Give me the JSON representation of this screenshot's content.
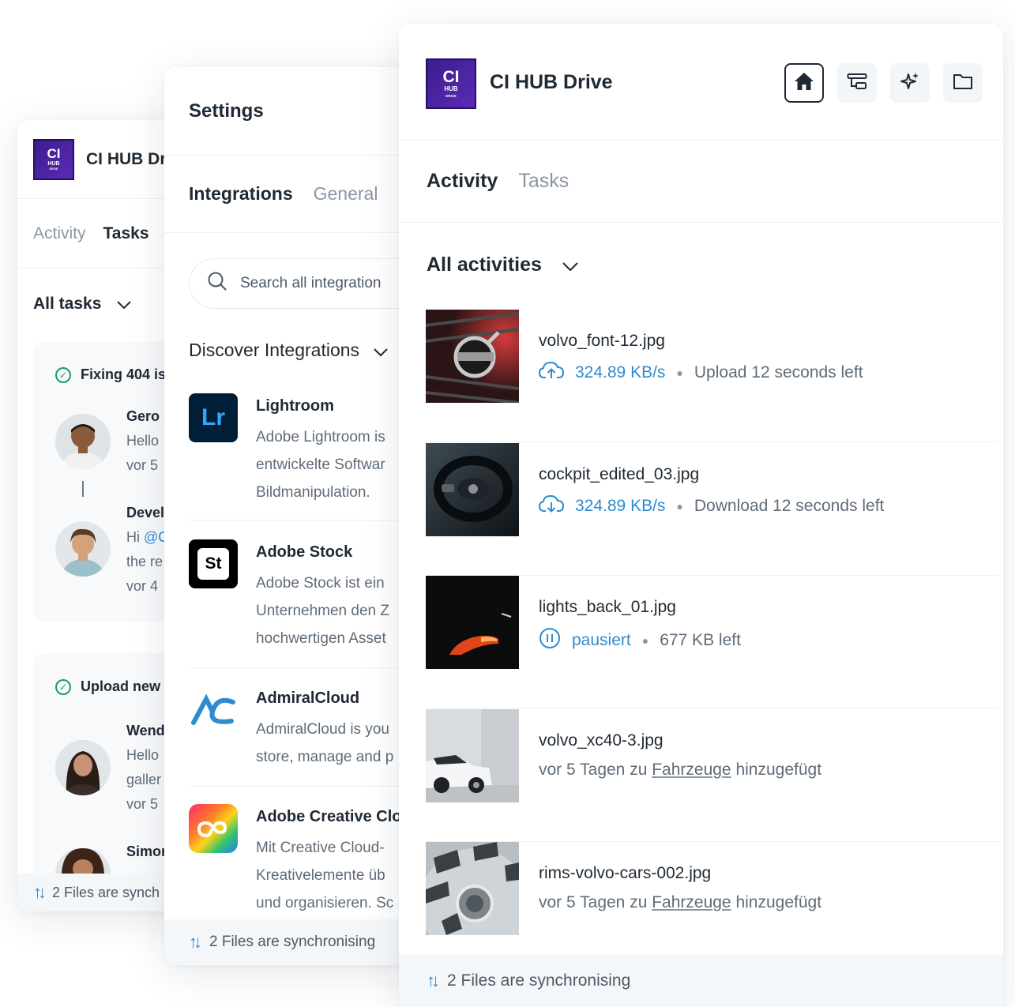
{
  "tasks_panel": {
    "logo": {
      "line1": "CI",
      "line2": "HUB",
      "line3": "DRIVE"
    },
    "app_title": "CI HUB Dr",
    "tabs": [
      {
        "label": "Activity"
      },
      {
        "label": "Tasks"
      }
    ],
    "filter_label": "All tasks",
    "tasks": [
      {
        "title": "Fixing 404 is",
        "comments": [
          {
            "name": "Gero S",
            "text": "Hello",
            "time": "vor 5"
          },
          {
            "name": "Devel",
            "mention_prefix": "Hi ",
            "mention": "@C",
            "text": "the re",
            "time": "vor 4"
          }
        ]
      },
      {
        "title": "Upload new",
        "comments": [
          {
            "name": "Wend",
            "text": "Hello",
            "text2": "galler",
            "time": "vor 5"
          },
          {
            "name": "Simor",
            "text": "",
            "time": ""
          }
        ]
      }
    ],
    "footer": "2 Files are synch"
  },
  "settings_panel": {
    "title": "Settings",
    "tabs": [
      {
        "label": "Integrations"
      },
      {
        "label": "General"
      }
    ],
    "search": {
      "placeholder": "Search all integration"
    },
    "discover_label": "Discover Integrations",
    "integrations": [
      {
        "name": "Lightroom",
        "icon": "Lr",
        "desc": [
          "Adobe Lightroom is",
          "entwickelte Softwar",
          "Bildmanipulation."
        ]
      },
      {
        "name": "Adobe Stock",
        "icon": "St",
        "desc": [
          "Adobe Stock ist ein",
          "Unternehmen den Z",
          "hochwertigen Asset"
        ]
      },
      {
        "name": "AdmiralCloud",
        "icon": "admiralcloud-logo",
        "desc": [
          "AdmiralCloud is you",
          "store, manage and p"
        ]
      },
      {
        "name": "Adobe Creative Clo",
        "icon": "creative-cloud-logo",
        "desc": [
          "Mit Creative Cloud-",
          "Kreativelemente üb",
          "und organisieren. Sc"
        ]
      }
    ],
    "footer": "2 Files are synchronising"
  },
  "drive_panel": {
    "logo": {
      "line1": "CI",
      "line2": "HUB",
      "line3": "DRIVE"
    },
    "app_title": "CI HUB Drive",
    "toolbar_icons": [
      "home-icon",
      "filter-icon",
      "sparkle-icon",
      "folder-icon"
    ],
    "tabs": [
      {
        "label": "Activity"
      },
      {
        "label": "Tasks"
      }
    ],
    "filter_label": "All activities",
    "activities": [
      {
        "file": "volvo_font-12.jpg",
        "status_icon": "cloud-upload-icon",
        "speed": "324.89 KB/s",
        "detail": "Upload 12 seconds left"
      },
      {
        "file": "cockpit_edited_03.jpg",
        "status_icon": "cloud-download-icon",
        "speed": "324.89 KB/s",
        "detail": "Download 12 seconds left"
      },
      {
        "file": "lights_back_01.jpg",
        "status_icon": "pause-icon",
        "speed": "pausiert",
        "detail": "677 KB left"
      },
      {
        "file": "volvo_xc40-3.jpg",
        "added_prefix": "vor 5 Tagen zu ",
        "collection": "Fahrzeuge",
        "added_suffix": " hinzugefügt"
      },
      {
        "file": "rims-volvo-cars-002.jpg",
        "added_prefix": "vor 5 Tagen zu ",
        "collection": "Fahrzeuge",
        "added_suffix": " hinzugefügt"
      }
    ],
    "footer": "2 Files are synchronising"
  },
  "colors": {
    "accent": "#2f8bd0",
    "success": "#1a9a6c",
    "logo": "#3b1d8c",
    "text": "#1f2933",
    "muted": "#5f6c78"
  }
}
